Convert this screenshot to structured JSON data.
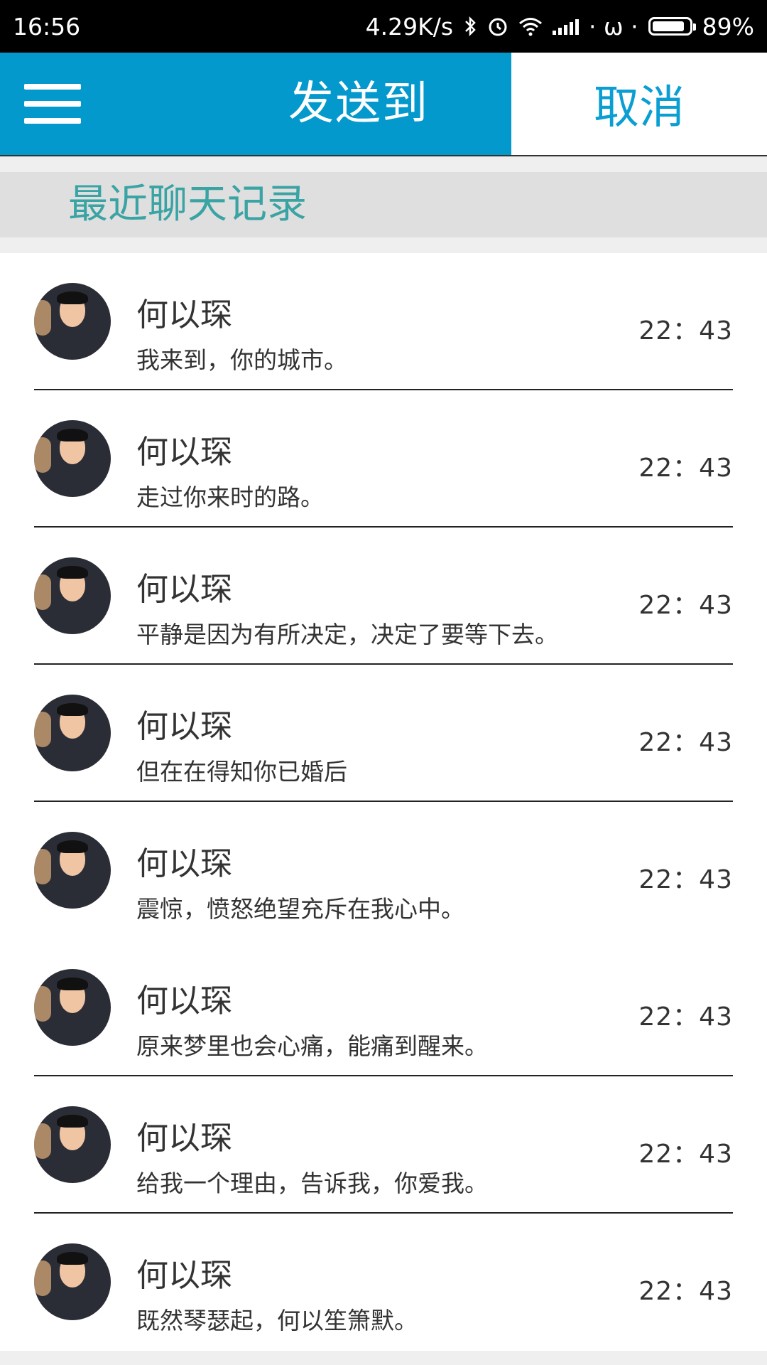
{
  "status_bar": {
    "time": "16:56",
    "network_speed": "4.29K/s",
    "bluetooth_icon": "bluetooth-icon",
    "alarm_icon": "alarm-icon",
    "wifi_icon": "wifi-icon",
    "signal_icon": "signal-icon",
    "dots": "· ω ·",
    "battery": "89%"
  },
  "header": {
    "title": "发送到",
    "cancel_label": "取消",
    "menu_icon": "menu-icon"
  },
  "section": {
    "title": "最近聊天记录"
  },
  "chats": [
    {
      "name": "何以琛",
      "message": "我来到，你的城市。",
      "time": "22：43"
    },
    {
      "name": "何以琛",
      "message": "走过你来时的路。",
      "time": "22：43"
    },
    {
      "name": "何以琛",
      "message": "平静是因为有所决定，决定了要等下去。",
      "time": "22：43"
    },
    {
      "name": "何以琛",
      "message": "但在在得知你已婚后",
      "time": "22：43"
    },
    {
      "name": "何以琛",
      "message": "震惊，愤怒绝望充斥在我心中。",
      "time": "22：43"
    },
    {
      "name": "何以琛",
      "message": "原来梦里也会心痛，能痛到醒来。",
      "time": "22：43"
    },
    {
      "name": "何以琛",
      "message": "给我一个理由，告诉我，你爱我。",
      "time": "22：43"
    },
    {
      "name": "何以琛",
      "message": "既然琴瑟起，何以笙箫默。",
      "time": "22：43"
    }
  ],
  "colors": {
    "header_blue": "#0399cc",
    "cancel_text": "#0a9ed3",
    "section_text": "#3aa3a3"
  }
}
